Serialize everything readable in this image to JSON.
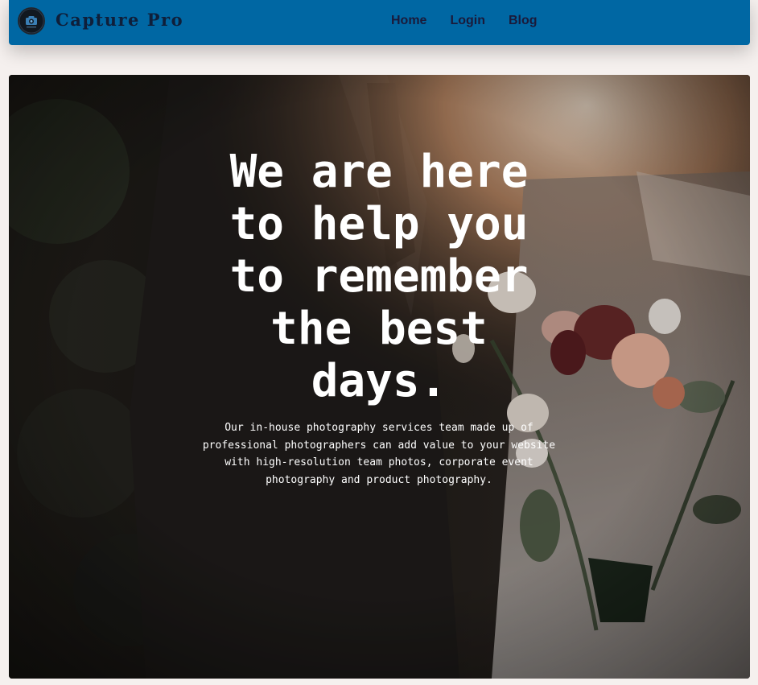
{
  "navbar": {
    "brand": "Capture Pro",
    "links": [
      "Home",
      "Login",
      "Blog"
    ],
    "background": "#0067a3"
  },
  "hero": {
    "title": "We are here to help you to remember the best days.",
    "text": "Our in-house photography services team made up of professional photographers can add value to your website with high-resolution team photos, corporate event photography and product photography.",
    "image_description_icon": "wedding-photo"
  }
}
